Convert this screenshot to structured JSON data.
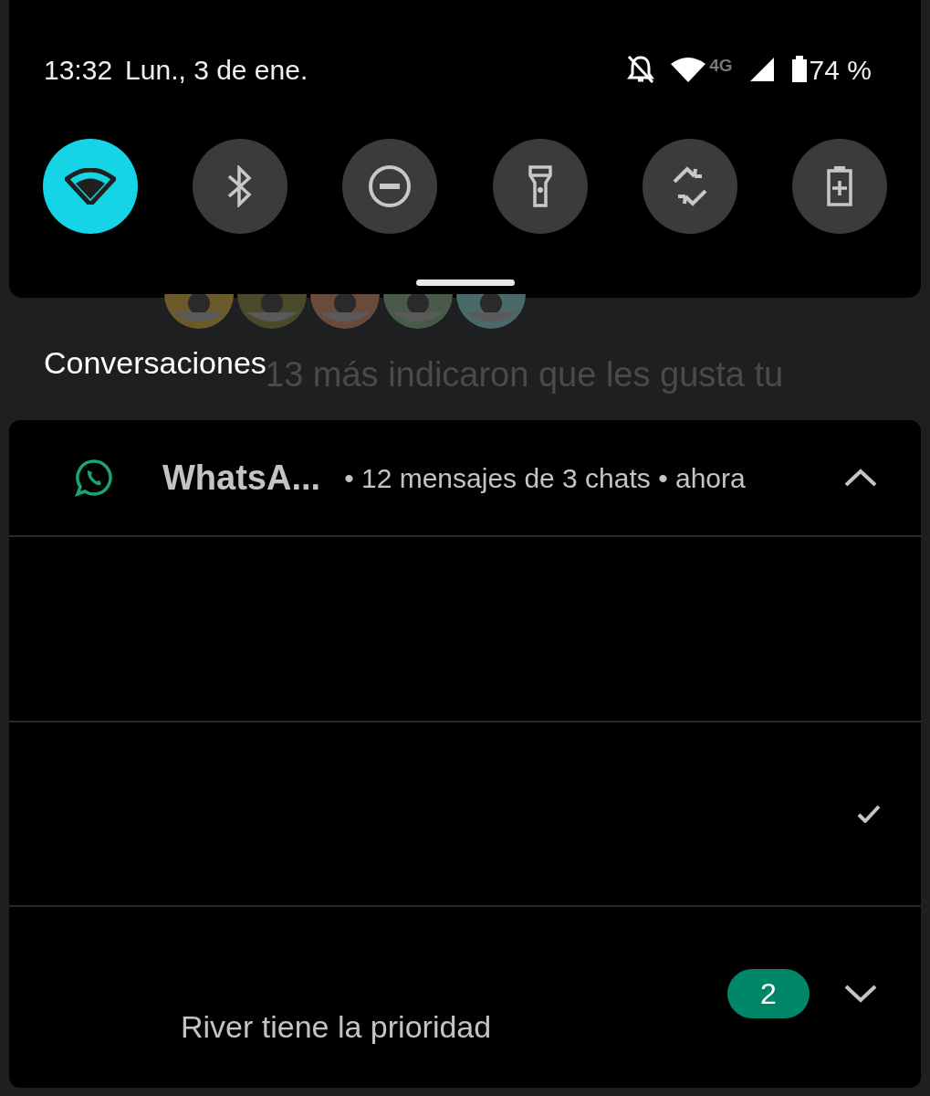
{
  "status_bar": {
    "time": "13:32",
    "date": "Lun., 3 de ene.",
    "network": "4G",
    "battery": "74 %"
  },
  "quick_tiles": [
    {
      "kind": "wifi",
      "on": true
    },
    {
      "kind": "bluetooth",
      "on": false
    },
    {
      "kind": "dnd",
      "on": false
    },
    {
      "kind": "flashlight",
      "on": false
    },
    {
      "kind": "rotate",
      "on": false
    },
    {
      "kind": "battery_saver",
      "on": false
    }
  ],
  "background_notification": {
    "text": "13 más indicaron que les gusta tu"
  },
  "section_title": "Conversaciones",
  "notification": {
    "app": "WhatsA...",
    "summary": "• 12 mensajes de 3 chats • ahora",
    "expanded": true,
    "rows": [
      {
        "kind": "empty"
      },
      {
        "kind": "read"
      },
      {
        "kind": "conversation",
        "text": "River tiene la prioridad",
        "count": "2",
        "expanded": false
      }
    ]
  }
}
